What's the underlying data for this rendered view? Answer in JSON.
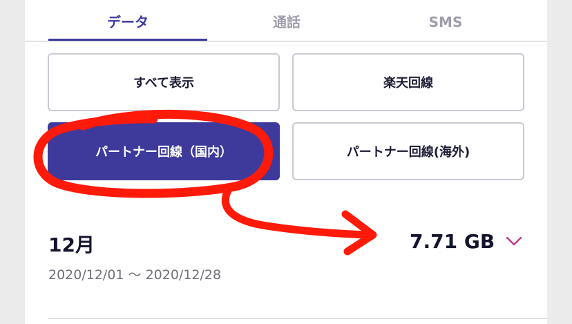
{
  "tabs": [
    {
      "label": "データ",
      "active": true
    },
    {
      "label": "通話",
      "active": false
    },
    {
      "label": "SMS",
      "active": false
    }
  ],
  "filters": {
    "all": "すべて表示",
    "rakuten_line": "楽天回線",
    "partner_domestic": "パートナー回線（国内）",
    "partner_overseas": "パートナー回線(海外)",
    "selected": "partner_domestic"
  },
  "usage": {
    "month": "12月",
    "period": "2020/12/01 〜 2020/12/28",
    "amount": "7.71 GB"
  },
  "colors": {
    "accent": "#3d3a9c",
    "chevron": "#c2388a",
    "annotation": "#ff1a0a"
  },
  "icons": {
    "expand": "chevron-down-icon"
  }
}
